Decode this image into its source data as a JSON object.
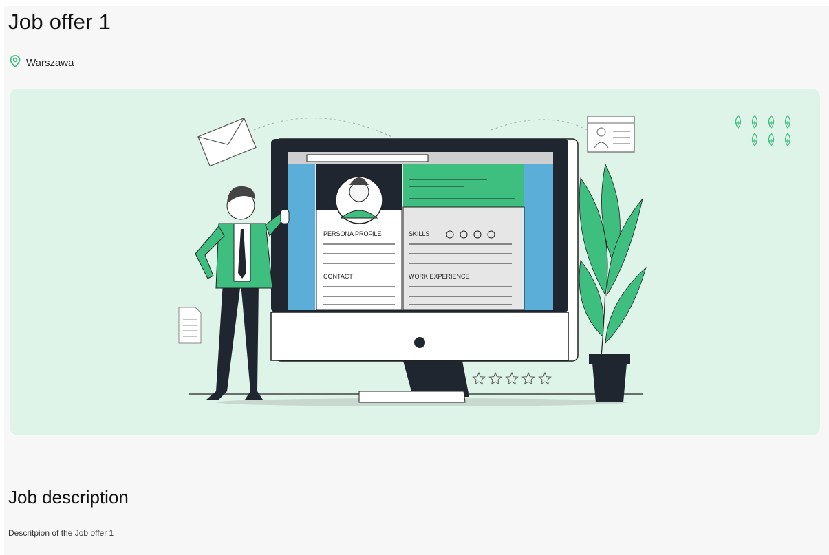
{
  "job": {
    "title": "Job offer 1",
    "location": "Warszawa",
    "location_icon": "map-pin-icon",
    "accent_color": "#3fbf7f"
  },
  "illustration": {
    "profile_label": "PERSONA PROFILE",
    "skills_label": "SKILLS",
    "contact_label": "CONTACT",
    "experience_label": "WORK EXPERIENCE",
    "rating_icon": "star-outline-icon",
    "rating_stars": 5
  },
  "description": {
    "heading": "Job description",
    "text": "Descritpion of the Job offer 1"
  }
}
